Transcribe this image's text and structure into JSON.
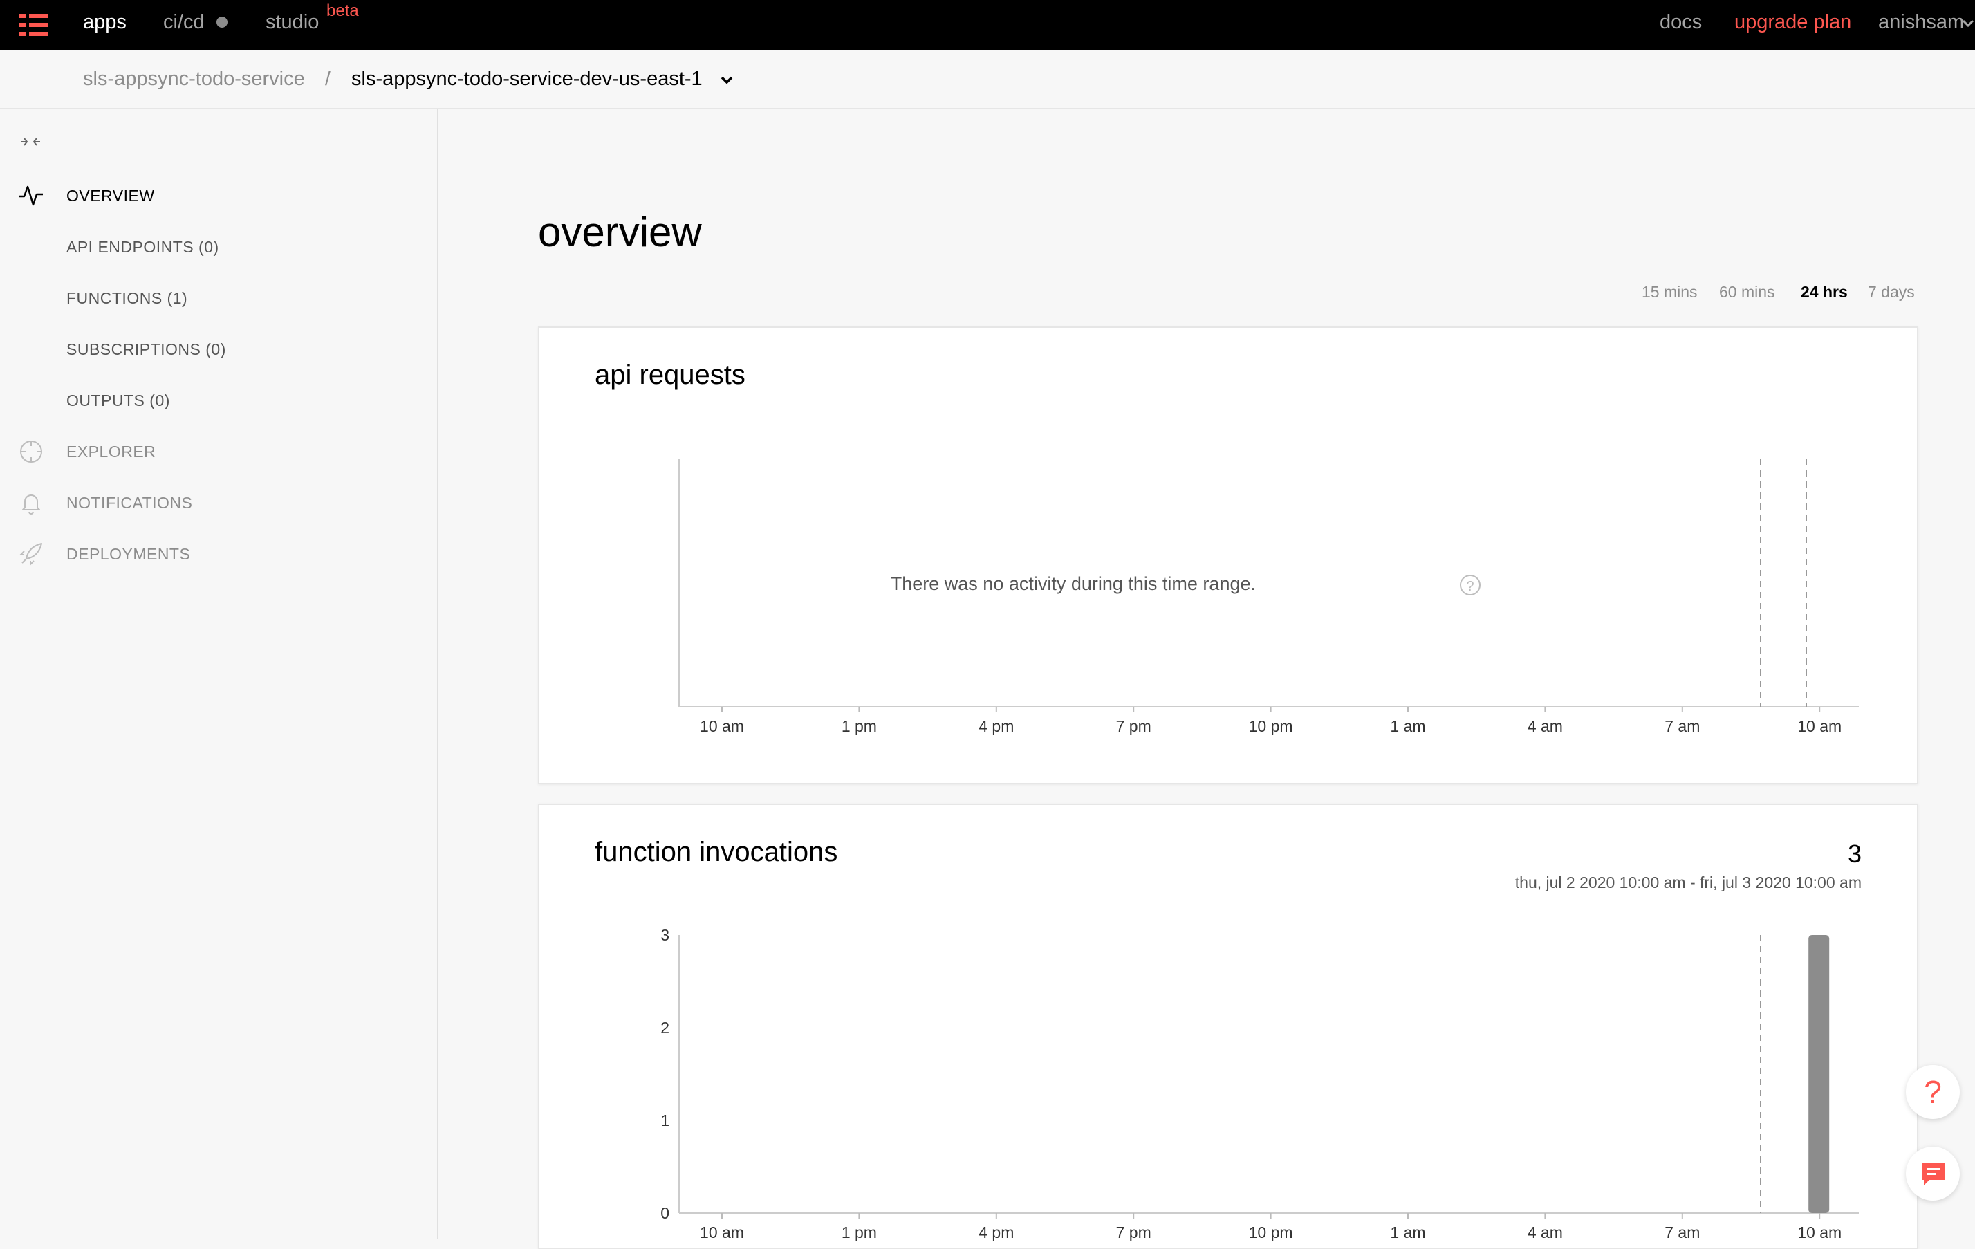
{
  "topnav": {
    "logo": "serverless-logo-icon",
    "links": [
      {
        "label": "apps"
      },
      {
        "label": "ci/cd"
      },
      {
        "label": "studio"
      }
    ],
    "beta": "beta",
    "docs": "docs",
    "upgrade": "upgrade plan",
    "user": "anishsam"
  },
  "breadcrumb": {
    "app": "sls-appsync-todo-service",
    "separator": "/",
    "instance": "sls-appsync-todo-service-dev-us-east-1"
  },
  "sidebar": {
    "items": [
      {
        "label": "OVERVIEW",
        "icon": "activity-icon"
      },
      {
        "label": "API ENDPOINTS (0)"
      },
      {
        "label": "FUNCTIONS (1)"
      },
      {
        "label": "SUBSCRIPTIONS (0)"
      },
      {
        "label": "OUTPUTS (0)"
      },
      {
        "label": "EXPLORER",
        "icon": "crosshair-icon"
      },
      {
        "label": "NOTIFICATIONS",
        "icon": "bell-icon"
      },
      {
        "label": "DEPLOYMENTS",
        "icon": "rocket-icon"
      }
    ]
  },
  "main": {
    "title": "overview",
    "ranges": [
      "15 mins",
      "60 mins",
      "24 hrs",
      "7 days"
    ],
    "selected_range": "24 hrs"
  },
  "api_card": {
    "title": "api requests",
    "empty_message": "There was no activity during this time range."
  },
  "invocations_card": {
    "title": "function invocations",
    "total": "3",
    "range_label": "thu, jul 2 2020 10:00 am - fri, jul 3 2020 10:00 am"
  },
  "chart_data": [
    {
      "type": "bar",
      "title": "api requests",
      "x_ticks": [
        "10 am",
        "1 pm",
        "4 pm",
        "7 pm",
        "10 pm",
        "1 am",
        "4 am",
        "7 am",
        "10 am"
      ],
      "series": [],
      "note": "There was no activity during this time range."
    },
    {
      "type": "bar",
      "title": "function invocations",
      "x_ticks": [
        "10 am",
        "1 pm",
        "4 pm",
        "7 pm",
        "10 pm",
        "1 am",
        "4 am",
        "7 am",
        "10 am"
      ],
      "y_ticks": [
        "0",
        "1",
        "2",
        "3"
      ],
      "ylim": [
        0,
        3
      ],
      "bars": [
        {
          "x": "10 am",
          "value": 3
        }
      ],
      "bar_color": "#8c8c8c"
    }
  ],
  "colors": {
    "accent": "#fd5750",
    "nav_bg": "#000000"
  }
}
